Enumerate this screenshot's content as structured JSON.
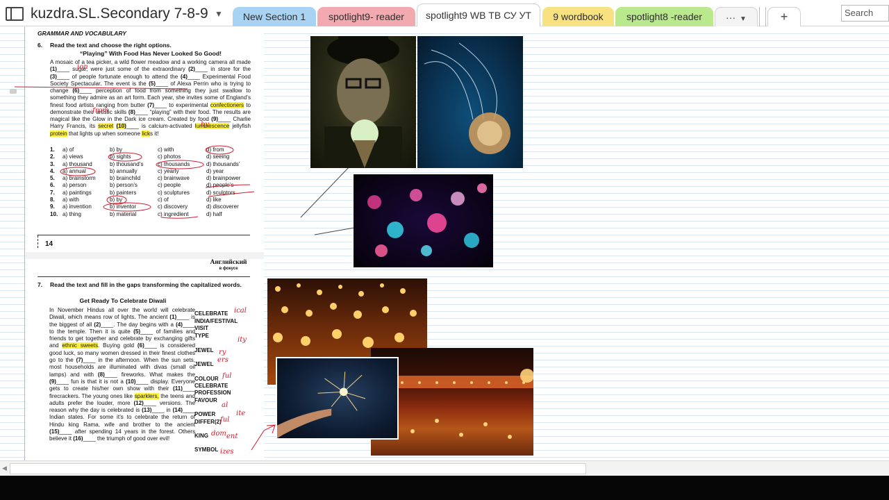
{
  "notebook": {
    "title": "kuzdra.SL.Secondary 7-8-9",
    "icon": "notebook-icon"
  },
  "tabs": [
    {
      "label": "New Section 1",
      "color": "#a9d3f3"
    },
    {
      "label": "spotlight9- reader",
      "color": "#f2aab0"
    },
    {
      "label": "spotlight9 WB ТВ СУ УТ",
      "color": "#ffffff",
      "active": true
    },
    {
      "label": "9 wordbook",
      "color": "#f7e180"
    },
    {
      "label": "spotlight8 -reader",
      "color": "#b9e88d"
    }
  ],
  "more_tabs_label": "···",
  "add_tab_label": "+",
  "search": {
    "placeholder": "Search (Ctrl"
  },
  "page": {
    "section_title": "GRAMMAR AND VOCABULARY",
    "ex6": {
      "number": "6.",
      "instruction": "Read the text and choose the right options.",
      "title": "“Playing” With Food Has Never Looked So Good!",
      "text": [
        {
          "t": "A mosaic of a tea picker, a wild flower meadow and a working camera all made "
        },
        {
          "t": "(1)",
          "b": true
        },
        {
          "t": "____ sugar, were just some of the extraordinary "
        },
        {
          "t": "(2)",
          "b": true
        },
        {
          "t": "____ in store for the "
        },
        {
          "t": "(3)",
          "b": true
        },
        {
          "t": "____ of people fortunate enough to attend the "
        },
        {
          "t": "(4)",
          "b": true
        },
        {
          "t": "____ Experimental Food Society Spectacular. The event is the "
        },
        {
          "t": "(5)",
          "b": true
        },
        {
          "t": "____ of Alexa Perrin who is trying to change "
        },
        {
          "t": "(6)",
          "b": true
        },
        {
          "t": "____ perception of food from something they just swallow to something they admire as an art form. Each year, she invites some of England’s finest food artists ranging from butter "
        },
        {
          "t": "(7)",
          "b": true
        },
        {
          "t": "____ to experimental "
        },
        {
          "t": "confectioners",
          "hl": true
        },
        {
          "t": " to demonstrate their artistic skills "
        },
        {
          "t": "(8)",
          "b": true
        },
        {
          "t": "____ “playing” with their food. The results are magical like the Glow in the Dark ice cream. Created by food "
        },
        {
          "t": "(9)",
          "b": true
        },
        {
          "t": "____ Charlie Harry Francis, its "
        },
        {
          "t": "secret",
          "hl": true
        },
        {
          "t": " "
        },
        {
          "t": "(10)",
          "b": true,
          "hl": true
        },
        {
          "t": "____ is calcium-activated "
        },
        {
          "t": "luminescence",
          "hl": true
        },
        {
          "t": " jellyfish "
        },
        {
          "t": "protein",
          "hl": true
        },
        {
          "t": " that lights up when someone "
        },
        {
          "t": "lick",
          "hl": true
        },
        {
          "t": "s it!"
        }
      ],
      "options": [
        {
          "n": "1.",
          "a": "a) of",
          "b": "b) by",
          "c": "c) with",
          "d": "d) from"
        },
        {
          "n": "2.",
          "a": "a) views",
          "b": "b) sights",
          "c": "c) photos",
          "d": "d) seeing"
        },
        {
          "n": "3.",
          "a": "a) thousand",
          "b": "b) thousand’s",
          "c": "c) thousands",
          "d": "d) thousands’"
        },
        {
          "n": "4.",
          "a": "a) annual",
          "b": "b) annually",
          "c": "c) yearly",
          "d": "d) year"
        },
        {
          "n": "5.",
          "a": "a) brainstorm",
          "b": "b) brainchild",
          "c": "c) brainwave",
          "d": "d) brainpower"
        },
        {
          "n": "6.",
          "a": "a) person",
          "b": "b) person’s",
          "c": "c) people",
          "d": "d) people’s"
        },
        {
          "n": "7.",
          "a": "a) paintings",
          "b": "b) painters",
          "c": "c) sculptures",
          "d": "d) sculptors"
        },
        {
          "n": "8.",
          "a": "a) with",
          "b": "b) by",
          "c": "c) of",
          "d": "d) like"
        },
        {
          "n": "9.",
          "a": "a) invention",
          "b": "b) inventor",
          "c": "c) discovery",
          "d": "d) discoverer"
        },
        {
          "n": "10.",
          "a": "a) thing",
          "b": "b) material",
          "c": "c) ingredient",
          "d": "d) half"
        }
      ]
    },
    "page_number": "14",
    "logo": {
      "main": "Английский",
      "sub": "в фокусе"
    },
    "ex7": {
      "number": "7.",
      "instruction": "Read the text and fill in the gaps transforming the capitalized words.",
      "title": "Get Ready To Celebrate Diwali",
      "text": [
        {
          "t": "In November Hindus all over the world will celebrate Diwali, which means row of lights. The ancient "
        },
        {
          "t": "(1)",
          "b": true
        },
        {
          "t": "____ is the biggest of all "
        },
        {
          "t": "(2)",
          "b": true
        },
        {
          "t": "____. The day begins with a "
        },
        {
          "t": "(4)",
          "b": true
        },
        {
          "t": "____ to the temple. Then it is quite "
        },
        {
          "t": "(5)",
          "b": true
        },
        {
          "t": "____ of families and friends to get together and celebrate by exchanging gifts and "
        },
        {
          "t": "ethnic sweets",
          "hl": true
        },
        {
          "t": ". Buying gold "
        },
        {
          "t": "(6)",
          "b": true
        },
        {
          "t": "____ is considered good luck, so many women dressed in their finest clothes go to the "
        },
        {
          "t": "(7)",
          "b": true
        },
        {
          "t": "____ in the afternoon. When the sun sets, most households are illuminated with divas (small oil lamps) and with "
        },
        {
          "t": "(8)",
          "b": true
        },
        {
          "t": "____ fireworks. What makes the "
        },
        {
          "t": "(9)",
          "b": true
        },
        {
          "t": "____ fun is that it is not a "
        },
        {
          "t": "(10)",
          "b": true
        },
        {
          "t": "____ display. Everyone gets to create his/her own show with their "
        },
        {
          "t": "(11)",
          "b": true
        },
        {
          "t": "____ firecrackers. The young ones like "
        },
        {
          "t": "sparklers,",
          "hl": true
        },
        {
          "t": " the teens and adults prefer the louder, more "
        },
        {
          "t": "(12)",
          "b": true
        },
        {
          "t": "____ versions. The reason why the day is celebrated is "
        },
        {
          "t": "(13)",
          "b": true
        },
        {
          "t": "____ in "
        },
        {
          "t": "(14)",
          "b": true
        },
        {
          "t": "____ Indian states. For some it’s to celebrate the return of Hindu king Rama, wife and brother to the ancient "
        },
        {
          "t": "(15)",
          "b": true
        },
        {
          "t": "____ after spending 14 years in the forest. Others believe it "
        },
        {
          "t": "(16)",
          "b": true
        },
        {
          "t": "____ the triumph of good over evil!"
        }
      ],
      "words": [
        "CELEBRATE",
        "INDIA/FESTIVAL",
        "VISIT",
        "TYPE",
        "JEWEL",
        "JEWEL",
        "COLOUR",
        "CELEBRATE",
        "PROFESSION",
        "FAVOUR",
        "POWER",
        "DIFFER(2)",
        "KING",
        "SYMBOL"
      ]
    }
  },
  "handwriting": [
    "from",
    "sights",
    "annual",
    "brainchild",
    "people's",
    "sculptors",
    "by",
    "inventor",
    "ingredient",
    "ion",
    "ical",
    "ity",
    "ry",
    "ers",
    "ful",
    "al",
    "ite",
    "ful",
    "ent",
    "dom",
    "izes"
  ],
  "images": [
    "glow-ice-cream-photo",
    "jellyfish-photo",
    "glowing-jellyfish-photo",
    "sky-lanterns-photo",
    "diwali-festival-photo",
    "sparkler-photo"
  ]
}
